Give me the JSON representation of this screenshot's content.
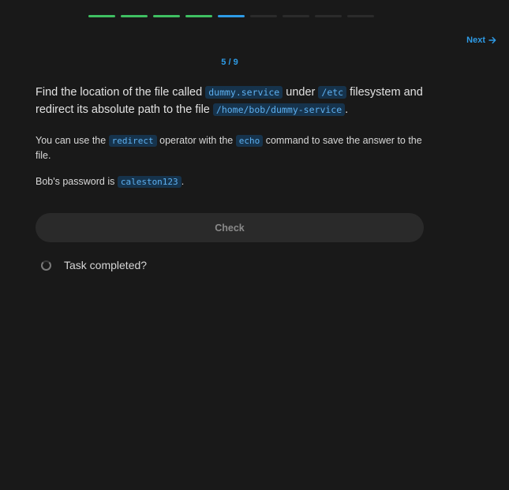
{
  "progress": {
    "segments": [
      "done",
      "done",
      "done",
      "done",
      "current",
      "todo",
      "todo",
      "todo",
      "todo"
    ]
  },
  "nav": {
    "next_label": "Next"
  },
  "counter": "5 / 9",
  "question": {
    "t1": "Find the location of the file called ",
    "c1": "dummy.service",
    "t2": " under ",
    "c2": "/etc",
    "t3": " filesystem and redirect its absolute path to the file ",
    "c3": "/home/bob/dummy-service",
    "t4": "."
  },
  "hint": {
    "t1": "You can use the ",
    "c1": "redirect",
    "t2": " operator with the ",
    "c2": "echo",
    "t3": " command to save the answer to the file."
  },
  "password": {
    "t1": "Bob's password is ",
    "c1": "caleston123",
    "t2": "."
  },
  "check_label": "Check",
  "task_label": "Task completed?"
}
